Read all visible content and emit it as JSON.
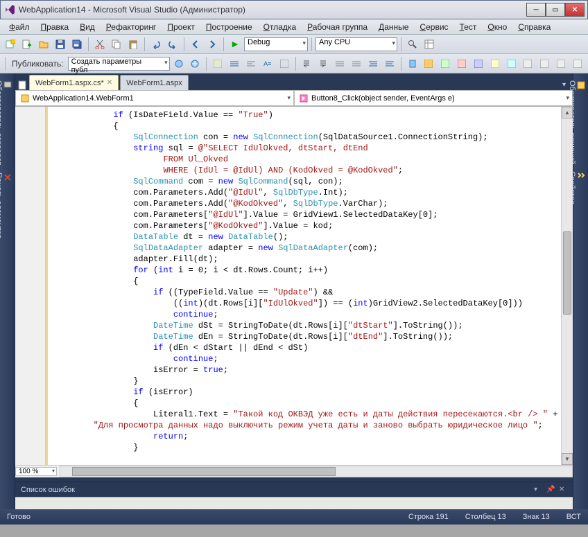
{
  "window": {
    "title": "WebApplication14 - Microsoft Visual Studio (Администратор)"
  },
  "menu": [
    "Файл",
    "Правка",
    "Вид",
    "Рефакторинг",
    "Проект",
    "Построение",
    "Отладка",
    "Рабочая группа",
    "Данные",
    "Сервис",
    "Тест",
    "Окно",
    "Справка"
  ],
  "toolbar1": {
    "config_label": "Debug",
    "platform_label": "Any CPU"
  },
  "toolbar2": {
    "publish_label": "Публиковать:",
    "publish_target": "Создать параметры публ"
  },
  "side_left": [
    "Обозреватель серверов",
    "Панель элементов"
  ],
  "side_right": [
    "Обозреватель решений",
    "Свойства"
  ],
  "tabs": [
    {
      "label": "WebForm1.aspx.cs*",
      "active": true
    },
    {
      "label": "WebForm1.aspx",
      "active": false
    }
  ],
  "nav": {
    "class": "WebApplication14.WebForm1",
    "member": "Button8_Click(object sender, EventArgs e)"
  },
  "zoom": "100 %",
  "error_list_title": "Список ошибок",
  "status": {
    "ready": "Готово",
    "line_label": "Строка",
    "line": "191",
    "col_label": "Столбец",
    "col": "13",
    "char_label": "Знак",
    "char": "13",
    "ins": "ВСТ"
  },
  "code_lines": [
    {
      "indent": 12,
      "parts": [
        {
          "t": "if",
          "c": "kw"
        },
        {
          "t": " (IsDateField.Value == "
        },
        {
          "t": "\"True\"",
          "c": "str"
        },
        {
          "t": ")"
        }
      ]
    },
    {
      "indent": 12,
      "parts": [
        {
          "t": "{"
        }
      ]
    },
    {
      "indent": 16,
      "parts": [
        {
          "t": "SqlConnection",
          "c": "type"
        },
        {
          "t": " con = "
        },
        {
          "t": "new",
          "c": "kw"
        },
        {
          "t": " "
        },
        {
          "t": "SqlConnection",
          "c": "type"
        },
        {
          "t": "(SqlDataSource1.ConnectionString);"
        }
      ]
    },
    {
      "indent": 16,
      "parts": [
        {
          "t": "string",
          "c": "kw"
        },
        {
          "t": " sql = "
        },
        {
          "t": "@\"SELECT IdUlOkved, dtStart, dtEnd",
          "c": "str"
        }
      ]
    },
    {
      "indent": 22,
      "parts": [
        {
          "t": "FROM Ul_Okved",
          "c": "str"
        }
      ]
    },
    {
      "indent": 22,
      "parts": [
        {
          "t": "WHERE (IdUl = @IdUl) AND (KodOkved = @KodOkved\"",
          "c": "str"
        },
        {
          "t": ";"
        }
      ]
    },
    {
      "indent": 16,
      "parts": [
        {
          "t": "SqlCommand",
          "c": "type"
        },
        {
          "t": " com = "
        },
        {
          "t": "new",
          "c": "kw"
        },
        {
          "t": " "
        },
        {
          "t": "SqlCommand",
          "c": "type"
        },
        {
          "t": "(sql, con);"
        }
      ]
    },
    {
      "indent": 16,
      "parts": [
        {
          "t": "com.Parameters.Add("
        },
        {
          "t": "\"@IdUl\"",
          "c": "str"
        },
        {
          "t": ", "
        },
        {
          "t": "SqlDbType",
          "c": "type"
        },
        {
          "t": ".Int);"
        }
      ]
    },
    {
      "indent": 16,
      "parts": [
        {
          "t": "com.Parameters.Add("
        },
        {
          "t": "\"@KodOkved\"",
          "c": "str"
        },
        {
          "t": ", "
        },
        {
          "t": "SqlDbType",
          "c": "type"
        },
        {
          "t": ".VarChar);"
        }
      ]
    },
    {
      "indent": 16,
      "parts": [
        {
          "t": "com.Parameters["
        },
        {
          "t": "\"@IdUl\"",
          "c": "str"
        },
        {
          "t": "].Value = GridView1.SelectedDataKey[0];"
        }
      ]
    },
    {
      "indent": 16,
      "parts": [
        {
          "t": "com.Parameters["
        },
        {
          "t": "\"@KodOkved\"",
          "c": "str"
        },
        {
          "t": "].Value = kod;"
        }
      ]
    },
    {
      "indent": 16,
      "parts": [
        {
          "t": "DataTable",
          "c": "type"
        },
        {
          "t": " dt = "
        },
        {
          "t": "new",
          "c": "kw"
        },
        {
          "t": " "
        },
        {
          "t": "DataTable",
          "c": "type"
        },
        {
          "t": "();"
        }
      ]
    },
    {
      "indent": 16,
      "parts": [
        {
          "t": "SqlDataAdapter",
          "c": "type"
        },
        {
          "t": " adapter = "
        },
        {
          "t": "new",
          "c": "kw"
        },
        {
          "t": " "
        },
        {
          "t": "SqlDataAdapter",
          "c": "type"
        },
        {
          "t": "(com);"
        }
      ]
    },
    {
      "indent": 16,
      "parts": [
        {
          "t": "adapter.Fill(dt);"
        }
      ]
    },
    {
      "indent": 16,
      "parts": [
        {
          "t": "for",
          "c": "kw"
        },
        {
          "t": " ("
        },
        {
          "t": "int",
          "c": "kw"
        },
        {
          "t": " i = 0; i < dt.Rows.Count; i++)"
        }
      ]
    },
    {
      "indent": 16,
      "parts": [
        {
          "t": "{"
        }
      ]
    },
    {
      "indent": 20,
      "parts": [
        {
          "t": "if",
          "c": "kw"
        },
        {
          "t": " ((TypeField.Value == "
        },
        {
          "t": "\"Update\"",
          "c": "str"
        },
        {
          "t": ") &&"
        }
      ]
    },
    {
      "indent": 24,
      "parts": [
        {
          "t": "(("
        },
        {
          "t": "int",
          "c": "kw"
        },
        {
          "t": ")(dt.Rows[i]["
        },
        {
          "t": "\"IdUlOkved\"",
          "c": "str"
        },
        {
          "t": "]) == ("
        },
        {
          "t": "int",
          "c": "kw"
        },
        {
          "t": ")GridView2.SelectedDataKey[0]))"
        }
      ]
    },
    {
      "indent": 24,
      "parts": [
        {
          "t": "continue",
          "c": "kw"
        },
        {
          "t": ";"
        }
      ]
    },
    {
      "indent": 20,
      "parts": [
        {
          "t": "DateTime",
          "c": "type"
        },
        {
          "t": " dSt = StringToDate(dt.Rows[i]["
        },
        {
          "t": "\"dtStart\"",
          "c": "str"
        },
        {
          "t": "].ToString());"
        }
      ]
    },
    {
      "indent": 20,
      "parts": [
        {
          "t": "DateTime",
          "c": "type"
        },
        {
          "t": " dEn = StringToDate(dt.Rows[i]["
        },
        {
          "t": "\"dtEnd\"",
          "c": "str"
        },
        {
          "t": "].ToString());"
        }
      ]
    },
    {
      "indent": 20,
      "parts": [
        {
          "t": "if",
          "c": "kw"
        },
        {
          "t": " (dEn < dStart || dEnd < dSt)"
        }
      ]
    },
    {
      "indent": 24,
      "parts": [
        {
          "t": "continue",
          "c": "kw"
        },
        {
          "t": ";"
        }
      ]
    },
    {
      "indent": 20,
      "parts": [
        {
          "t": "isError = "
        },
        {
          "t": "true",
          "c": "kw"
        },
        {
          "t": ";"
        }
      ]
    },
    {
      "indent": 16,
      "parts": [
        {
          "t": "}"
        }
      ]
    },
    {
      "indent": 16,
      "parts": [
        {
          "t": "if",
          "c": "kw"
        },
        {
          "t": " (isError)"
        }
      ]
    },
    {
      "indent": 16,
      "parts": [
        {
          "t": "{"
        }
      ]
    },
    {
      "indent": 20,
      "parts": [
        {
          "t": "Literal1.Text = "
        },
        {
          "t": "\"Такой код ОКВЭД уже есть и даты действия пересекаются.<br /> \"",
          "c": "str"
        },
        {
          "t": " +"
        }
      ]
    },
    {
      "indent": 8,
      "parts": [
        {
          "t": "\"Для просмотра данных надо выключить режим учета даты и заново выбрать юридическое лицо \"",
          "c": "str"
        },
        {
          "t": ";"
        }
      ]
    },
    {
      "indent": 20,
      "parts": [
        {
          "t": "return",
          "c": "kw"
        },
        {
          "t": ";"
        }
      ]
    },
    {
      "indent": 16,
      "parts": [
        {
          "t": "}"
        }
      ]
    }
  ]
}
